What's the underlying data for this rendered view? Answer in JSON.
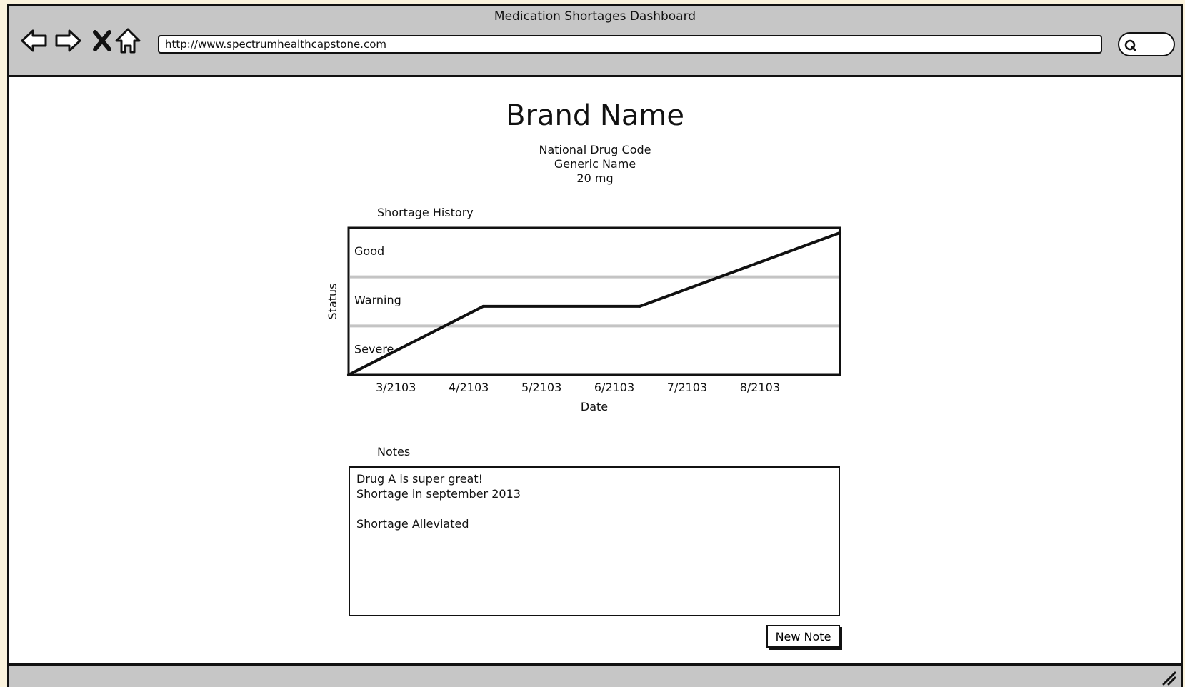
{
  "window": {
    "title": "Medication Shortages Dashboard"
  },
  "browser": {
    "url": "http://www.spectrumhealthcapstone.com",
    "icons": [
      "back-arrow-icon",
      "forward-arrow-icon",
      "close-icon",
      "home-icon",
      "search-icon",
      "resize-grip-icon"
    ]
  },
  "drug": {
    "brand_name": "Brand Name",
    "ndc_label": "National Drug Code",
    "generic_label": "Generic Name",
    "dose": "20 mg"
  },
  "shortage_history": {
    "label": "Shortage History"
  },
  "chart_data": {
    "type": "line",
    "title": "Shortage History",
    "xlabel": "Date",
    "ylabel": "Status",
    "categories": [
      "3/2103",
      "4/2103",
      "5/2103",
      "6/2103",
      "7/2103",
      "8/2103"
    ],
    "status_bands": [
      "Good",
      "Warning",
      "Severe"
    ],
    "grid": true,
    "series": [
      {
        "x": [
          2.35,
          4.2,
          6.35,
          9.1
        ],
        "y": [
          0.0,
          1.4,
          1.4,
          2.9
        ]
      }
    ],
    "x_range": [
      2.35,
      9.1
    ],
    "y_range": [
      0,
      3
    ],
    "line_color": "#111111",
    "band_line_color": "#c4c4c4"
  },
  "notes": {
    "label": "Notes",
    "lines": [
      "Drug A is super great!",
      "Shortage in september 2013",
      "",
      "Shortage Alleviated"
    ]
  },
  "actions": {
    "new_note_label": "New Note"
  }
}
